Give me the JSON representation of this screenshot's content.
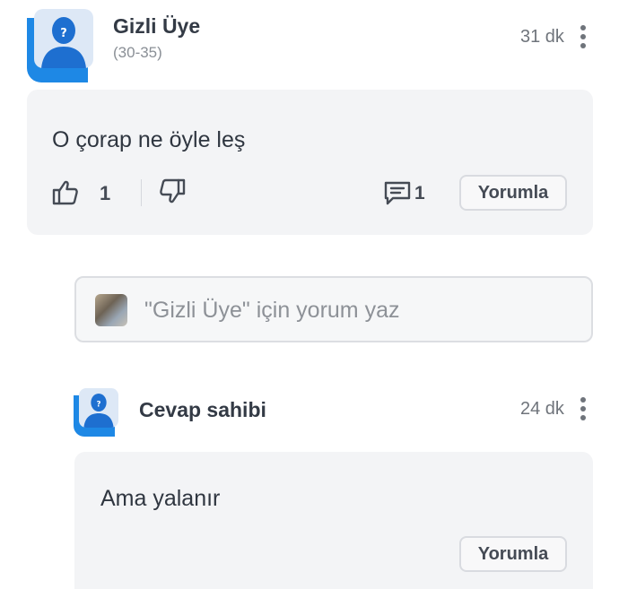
{
  "post": {
    "author": "Gizli Üye",
    "author_meta": "(30-35)",
    "time": "31 dk",
    "text": "O çorap ne öyle leş",
    "like_count": "1",
    "comment_count": "1",
    "reply_label": "Yorumla"
  },
  "comment_box": {
    "placeholder": "\"Gizli Üye\" için yorum yaz"
  },
  "reply": {
    "author": "Cevap sahibi",
    "time": "24 dk",
    "text": "Ama yalanır",
    "reply_label": "Yorumla"
  },
  "colors": {
    "accent": "#1e88e5",
    "avatar_bg": "#dde8f6",
    "card_bg": "#f3f4f6"
  },
  "icons": [
    "anonymous-avatar-icon",
    "more-options-icon",
    "thumbs-up-icon",
    "thumbs-down-icon",
    "comment-icon"
  ]
}
